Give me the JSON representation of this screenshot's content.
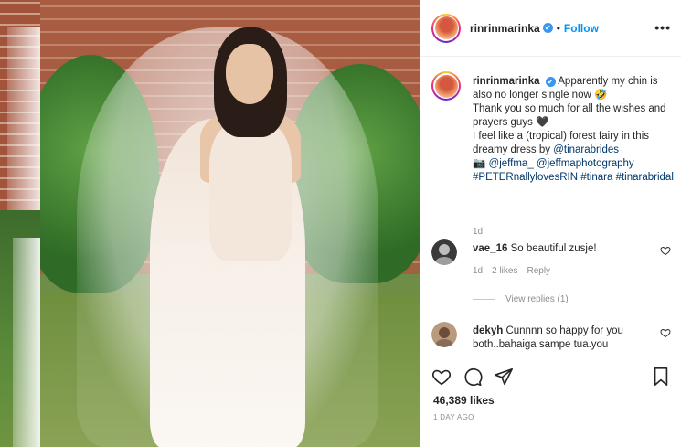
{
  "post": {
    "username": "rinrinmarinka",
    "verified": "✔",
    "separator": "•",
    "follow_label": "Follow",
    "more_label": "•••"
  },
  "caption": {
    "username": "rinrinmarinka",
    "line1": "Apparently my chin is also no longer single now 🤣",
    "line2": "Thank you so much for all the wishes and prayers guys 🖤",
    "line3": "I feel like a (tropical) forest fairy in this dreamy dress by",
    "mention_designer": "@tinarabrides",
    "camera_icon": "📷",
    "mention_photo1": "@jeffma_",
    "mention_photo2": "@jeffmaphotography",
    "hashtags": "#PETERnallylovesRIN #tinara #tinarabridal",
    "time": "1d"
  },
  "comments": [
    {
      "username": "vae_16",
      "text": "So beautiful zusje!",
      "time": "1d",
      "likes": "2 likes",
      "reply_label": "Reply",
      "view_replies": "View replies (1)"
    },
    {
      "username": "dekyh",
      "text": "Cunnnn so happy for you both..bahaiga sampe tua.you"
    }
  ],
  "footer": {
    "likes": "46,389 likes",
    "date": "1 DAY AGO"
  },
  "colors": {
    "accent": "#0095f6",
    "verified": "#3897f0",
    "text": "#262626",
    "muted": "#8e8e8e"
  }
}
